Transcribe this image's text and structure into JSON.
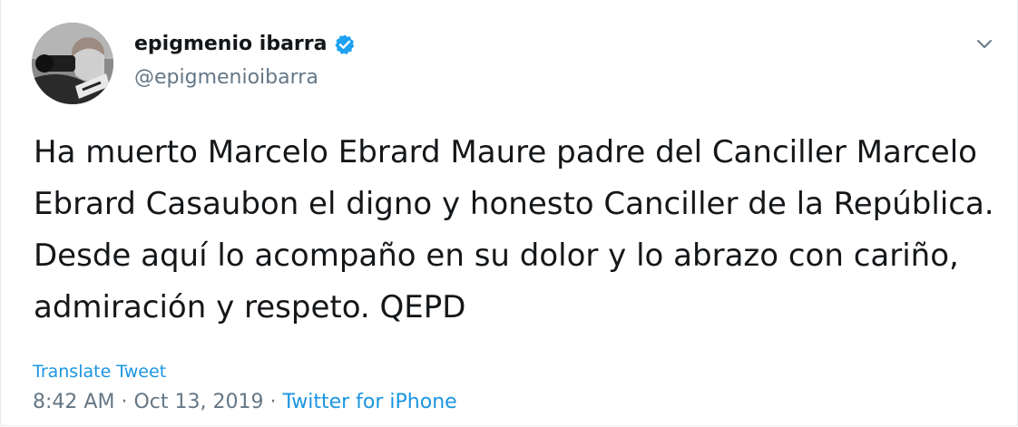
{
  "tweet": {
    "author": {
      "display_name": "epigmenio ibarra",
      "handle": "@epigmenioibarra",
      "verified": true,
      "avatar_icon": "profile-photo"
    },
    "text": "Ha muerto Marcelo Ebrard Maure padre del Canciller Marcelo Ebrard Casaubon el digno y honesto Canciller de la República. Desde aquí lo acompaño en su dolor y lo abrazo con cariño, admiración y respeto. QEPD",
    "translate_label": "Translate Tweet",
    "time": "8:42 AM",
    "separator": "·",
    "date": "Oct 13, 2019",
    "source": "Twitter for iPhone",
    "menu_icon": "chevron-down-icon"
  },
  "colors": {
    "primary_text": "#14171a",
    "secondary_text": "#657786",
    "link": "#1b95e0",
    "verified_badge": "#1da1f2",
    "border": "#e6ecf0"
  }
}
